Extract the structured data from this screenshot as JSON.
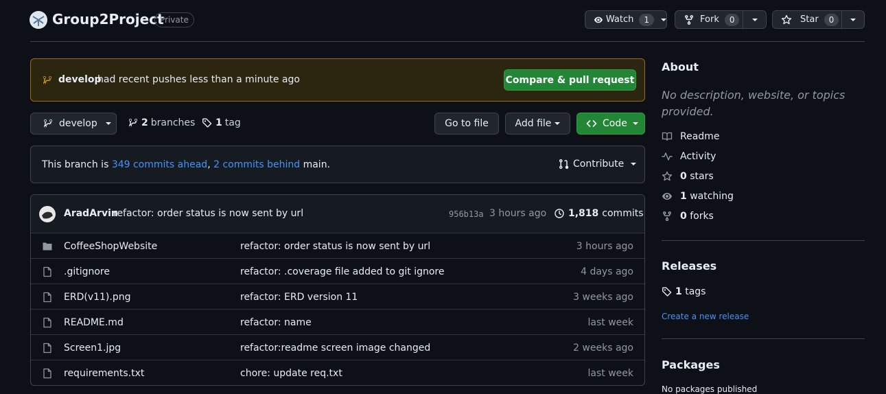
{
  "repo": {
    "name": "Group2Project",
    "visibility": "Private"
  },
  "header_actions": {
    "watch": {
      "label": "Watch",
      "count": "1"
    },
    "fork": {
      "label": "Fork",
      "count": "0"
    },
    "star": {
      "label": "Star",
      "count": "0"
    }
  },
  "push_banner": {
    "branch": "develop",
    "text": "had recent pushes less than a minute ago",
    "button": "Compare & pull request"
  },
  "toolbar": {
    "branch": "develop",
    "branches_count": "2",
    "branches_label": "branches",
    "tags_count": "1",
    "tags_label": "tag",
    "go_to_file": "Go to file",
    "add_file": "Add file",
    "code": "Code"
  },
  "branch_status": {
    "prefix": "This branch is",
    "ahead": "349 commits ahead",
    "sep": ",",
    "behind": "2 commits behind",
    "suffix": "main.",
    "contribute": "Contribute"
  },
  "last_commit": {
    "author": "AradArvin",
    "message": "refactor: order status is now sent by url",
    "hash": "956b13a",
    "time": "3 hours ago",
    "commits_count": "1,818",
    "commits_label": "commits"
  },
  "files": [
    {
      "type": "folder",
      "name": "CoffeeShopWebsite",
      "message": "refactor: order status is now sent by url",
      "date": "3 hours ago"
    },
    {
      "type": "file",
      "name": ".gitignore",
      "message": "refactor: .coverage file added to git ignore",
      "date": "4 days ago"
    },
    {
      "type": "file",
      "name": "ERD(v11).png",
      "message": "refactor: ERD version 11",
      "date": "3 weeks ago"
    },
    {
      "type": "file",
      "name": "README.md",
      "message": "refactor: name",
      "date": "last week"
    },
    {
      "type": "file",
      "name": "Screen1.jpg",
      "message": "refactor:readme screen image changed",
      "date": "2 weeks ago"
    },
    {
      "type": "file",
      "name": "requirements.txt",
      "message": "chore: update req.txt",
      "date": "last week"
    }
  ],
  "about": {
    "title": "About",
    "description": "No description, website, or topics provided.",
    "readme": "Readme",
    "activity": "Activity",
    "stars_count": "0",
    "stars_label": "stars",
    "watching_count": "1",
    "watching_label": "watching",
    "forks_count": "0",
    "forks_label": "forks"
  },
  "releases": {
    "title": "Releases",
    "tags_count": "1",
    "tags_label": "tags",
    "create_link": "Create a new release"
  },
  "packages": {
    "title": "Packages",
    "empty": "No packages published"
  },
  "colors": {
    "background": "#0d1117",
    "accent_green": "#238636",
    "link": "#4493f8",
    "banner_border": "#9e6a03"
  }
}
